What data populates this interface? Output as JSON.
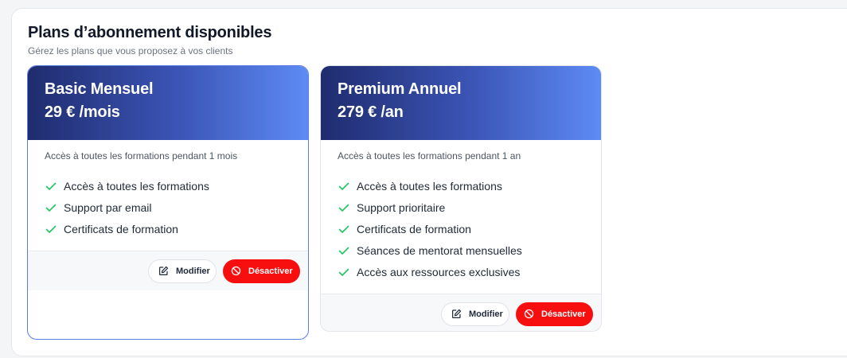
{
  "section": {
    "title": "Plans d’abonnement disponibles",
    "subtitle": "Gérez les plans que vous proposez à vos clients"
  },
  "plans": [
    {
      "name": "Basic Mensuel",
      "price": "29 € /mois",
      "description": "Accès à toutes les formations pendant 1 mois",
      "features": [
        "Accès à toutes les formations",
        "Support par email",
        "Certificats de formation"
      ],
      "edit_label": "Modifier",
      "deactivate_label": "Désactiver"
    },
    {
      "name": "Premium Annuel",
      "price": "279 € /an",
      "description": "Accès à toutes les formations pendant 1 an",
      "features": [
        "Accès à toutes les formations",
        "Support prioritaire",
        "Certificats de formation",
        "Séances de mentorat mensuelles",
        "Accès aux ressources exclusives"
      ],
      "edit_label": "Modifier",
      "deactivate_label": "Désactiver"
    }
  ],
  "icons": {
    "feature": "check-icon",
    "edit": "edit-icon",
    "deactivate": "ban-icon"
  },
  "colors": {
    "accent_dark": "#1f2c6e",
    "accent_light": "#5d8bf4",
    "danger": "#f70f0f",
    "check": "#22c55e"
  }
}
